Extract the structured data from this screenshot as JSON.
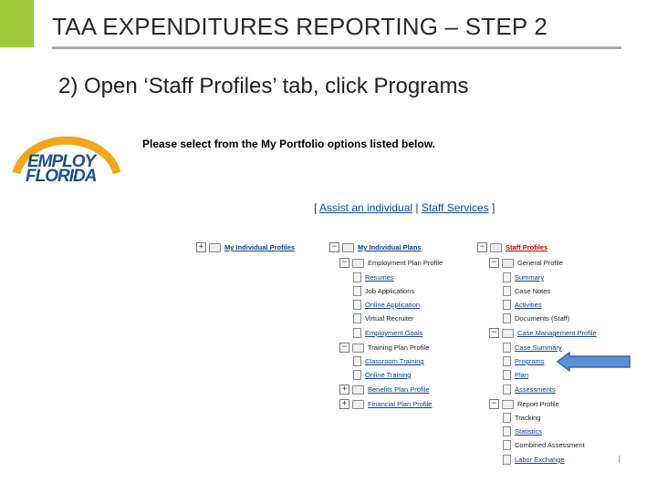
{
  "slide": {
    "title": "TAA EXPENDITURES REPORTING – STEP 2",
    "instruction": "2) Open ‘Staff Profiles’ tab, click Programs"
  },
  "logo": {
    "line1": "EMPLOY",
    "line2": "FLORIDA"
  },
  "portfolio": {
    "prompt": "Please select from the My Portfolio options listed below.",
    "open_bracket": "[",
    "assist_link": "Assist an individual",
    "separator": "|",
    "staff_link": "Staff Services",
    "close_bracket": "]"
  },
  "tree": {
    "my_individual_profiles": "My Individual Profiles",
    "my_individual_plans": {
      "label": "My Individual Plans",
      "employment_plan_profile": "Employment Plan Profile",
      "resumes": "Resumes",
      "job_applications": "Job Applications",
      "online_application": "Online Application",
      "virtual_recruiter": "Virtual Recruiter",
      "employment_goals": "Employment Goals",
      "training_plan_profile": "Training Plan Profile",
      "classroom_training": "Classroom Training",
      "online_training": "Online Training",
      "benefits_plan_profile": "Benefits Plan Profile",
      "financial_plan_profile": "Financial Plan Profile"
    },
    "staff_profiles": {
      "label": "Staff Profiles",
      "general_profile": "General Profile",
      "summary": "Summary",
      "case_notes": "Case Notes",
      "activities": "Activities",
      "documents_staff": "Documents (Staff)",
      "case_management_profile": "Case Management Profile",
      "case_summary": "Case Summary",
      "programs": "Programs",
      "plan": "Plan",
      "assessments": "Assessments",
      "report_profile": "Report Profile",
      "tracking": "Tracking",
      "statistics": "Statistics",
      "combined_assessment": "Combined Assessment",
      "labor_exchange": "Labor Exchange"
    }
  },
  "colors": {
    "accent": "#9ccc3c",
    "arrow_fill": "#5b8fd6",
    "arrow_stroke": "#3a6ab0",
    "link": "#0b3d91",
    "active_tab": "#c00000"
  }
}
